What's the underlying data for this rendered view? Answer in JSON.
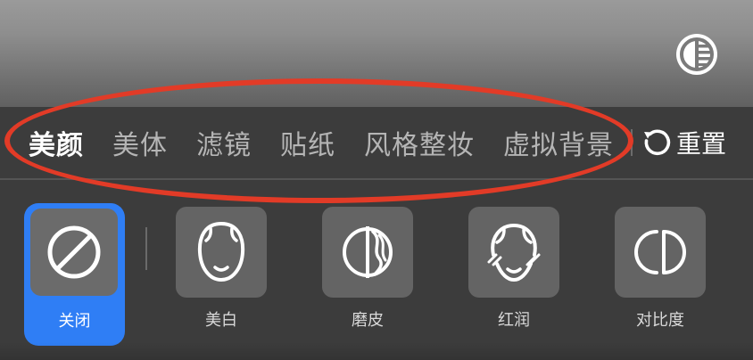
{
  "tabs": [
    {
      "label": "美颜",
      "active": true
    },
    {
      "label": "美体",
      "active": false
    },
    {
      "label": "滤镜",
      "active": false
    },
    {
      "label": "贴纸",
      "active": false
    },
    {
      "label": "风格整妆",
      "active": false
    },
    {
      "label": "虚拟背景",
      "active": false
    }
  ],
  "reset": {
    "label": "重置",
    "icon": "reset-icon"
  },
  "contrast_toggle": {
    "icon": "contrast-compare-icon"
  },
  "effects": {
    "off": {
      "label": "关闭",
      "icon": "disabled-circle-icon",
      "selected": true
    },
    "items": [
      {
        "label": "美白",
        "icon": "face-whitening-icon"
      },
      {
        "label": "磨皮",
        "icon": "skin-smoothing-icon"
      },
      {
        "label": "红润",
        "icon": "rosy-face-icon"
      },
      {
        "label": "对比度",
        "icon": "contrast-icon"
      }
    ]
  },
  "colors": {
    "selected_accent": "#2F7EF5",
    "annotation_oval": "#E23B27",
    "panel_background": "#3C3C3C",
    "tile_background": "#646464"
  }
}
